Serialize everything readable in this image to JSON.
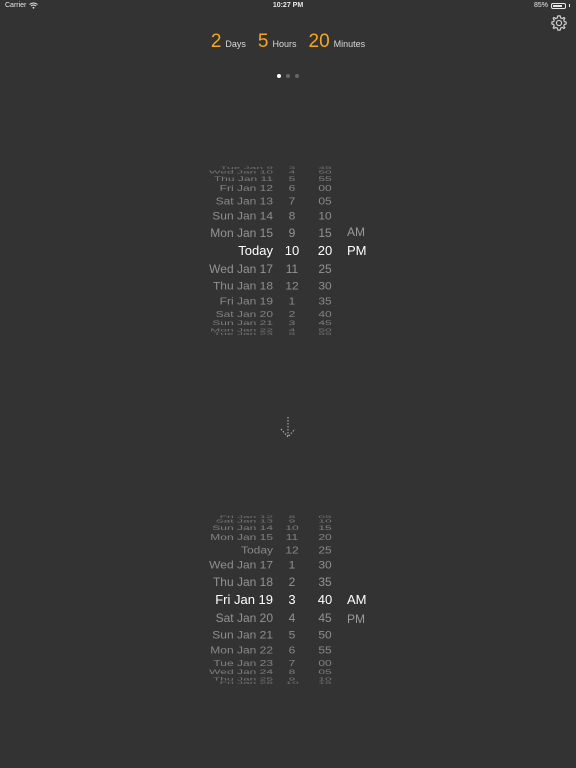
{
  "status_bar": {
    "carrier": "Carrier",
    "time": "10:27 PM",
    "battery": "85%",
    "battery_level": 0.85
  },
  "duration": {
    "days": "2",
    "days_label": "Days",
    "hours": "5",
    "hours_label": "Hours",
    "minutes": "20",
    "minutes_label": "Minutes"
  },
  "pager": {
    "count": 3,
    "active_index": 0
  },
  "start_picker": {
    "rows": [
      {
        "date": "Tue Jan 9",
        "hour": "3",
        "minute": "45"
      },
      {
        "date": "Wed Jan 10",
        "hour": "4",
        "minute": "50"
      },
      {
        "date": "Thu Jan 11",
        "hour": "5",
        "minute": "55"
      },
      {
        "date": "Fri Jan 12",
        "hour": "6",
        "minute": "00"
      },
      {
        "date": "Sat Jan 13",
        "hour": "7",
        "minute": "05"
      },
      {
        "date": "Sun Jan 14",
        "hour": "8",
        "minute": "10"
      },
      {
        "date": "Mon Jan 15",
        "hour": "9",
        "minute": "15"
      },
      {
        "date": "Today",
        "hour": "10",
        "minute": "20"
      },
      {
        "date": "Wed Jan 17",
        "hour": "11",
        "minute": "25"
      },
      {
        "date": "Thu Jan 18",
        "hour": "12",
        "minute": "30"
      },
      {
        "date": "Fri Jan 19",
        "hour": "1",
        "minute": "35"
      },
      {
        "date": "Sat Jan 20",
        "hour": "2",
        "minute": "40"
      },
      {
        "date": "Sun Jan 21",
        "hour": "3",
        "minute": "45"
      },
      {
        "date": "Mon Jan 22",
        "hour": "4",
        "minute": "50"
      },
      {
        "date": "Tue Jan 23",
        "hour": "5",
        "minute": "55"
      }
    ],
    "selected_index": 7,
    "ampm_options": [
      "AM",
      "PM"
    ],
    "ampm_selected": "PM"
  },
  "end_picker": {
    "rows": [
      {
        "date": "Fri Jan 12",
        "hour": "8",
        "minute": "05"
      },
      {
        "date": "Sat Jan 13",
        "hour": "9",
        "minute": "10"
      },
      {
        "date": "Sun Jan 14",
        "hour": "10",
        "minute": "15"
      },
      {
        "date": "Mon Jan 15",
        "hour": "11",
        "minute": "20"
      },
      {
        "date": "Today",
        "hour": "12",
        "minute": "25"
      },
      {
        "date": "Wed Jan 17",
        "hour": "1",
        "minute": "30"
      },
      {
        "date": "Thu Jan 18",
        "hour": "2",
        "minute": "35"
      },
      {
        "date": "Fri Jan 19",
        "hour": "3",
        "minute": "40"
      },
      {
        "date": "Sat Jan 20",
        "hour": "4",
        "minute": "45"
      },
      {
        "date": "Sun Jan 21",
        "hour": "5",
        "minute": "50"
      },
      {
        "date": "Mon Jan 22",
        "hour": "6",
        "minute": "55"
      },
      {
        "date": "Tue Jan 23",
        "hour": "7",
        "minute": "00"
      },
      {
        "date": "Wed Jan 24",
        "hour": "8",
        "minute": "05"
      },
      {
        "date": "Thu Jan 25",
        "hour": "9",
        "minute": "10"
      },
      {
        "date": "Fri Jan 26",
        "hour": "10",
        "minute": "15"
      }
    ],
    "selected_index": 7,
    "ampm_options": [
      "AM",
      "PM"
    ],
    "ampm_selected": "AM"
  },
  "icons": {
    "settings": "gear-icon",
    "arrow": "arrow-down-icon",
    "wifi": "wifi-icon",
    "battery": "battery-icon"
  },
  "colors": {
    "background": "#333333",
    "accent": "#f5a623",
    "selected_text": "#ffffff",
    "dim_text": "#9a9a9a"
  }
}
